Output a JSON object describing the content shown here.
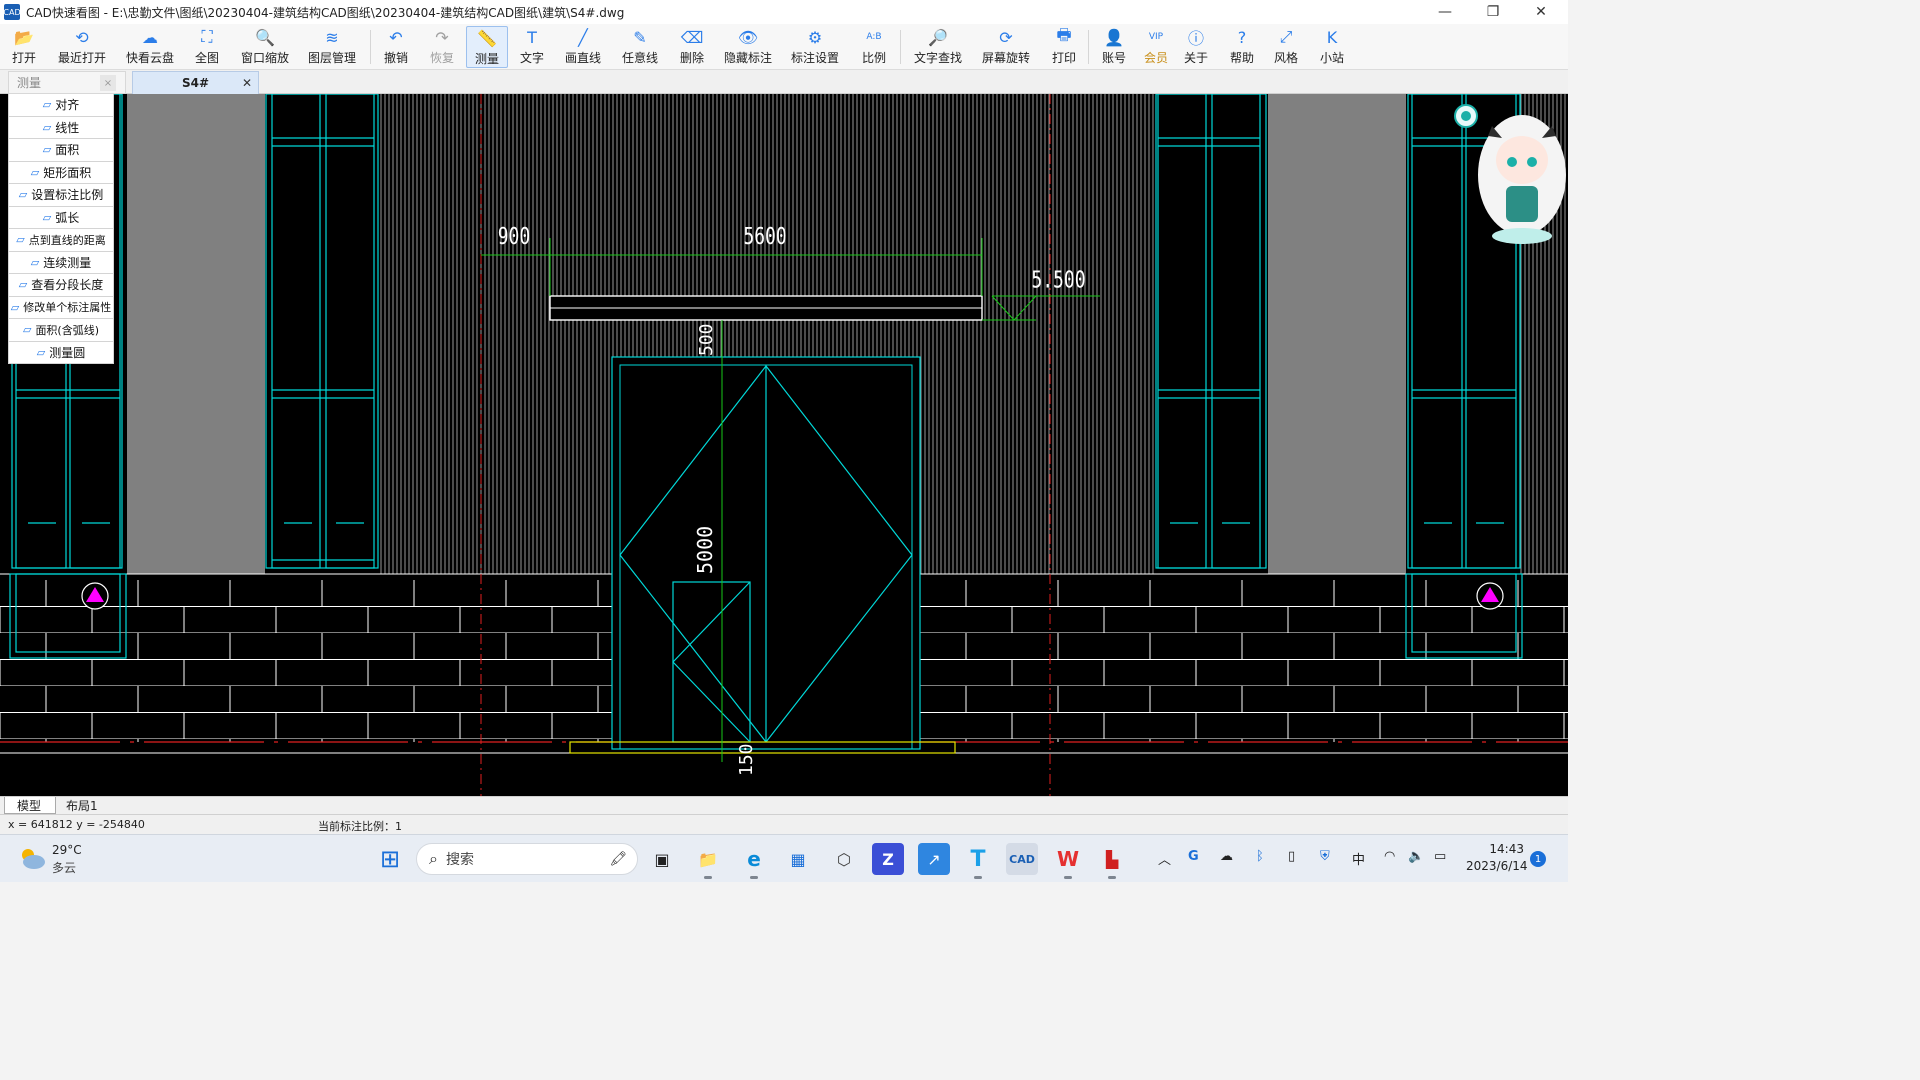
{
  "window": {
    "title": "CAD快速看图 - E:\\忠勤文件\\图纸\\20230404-建筑结构CAD图纸\\20230404-建筑结构CAD图纸\\建筑\\S4#.dwg",
    "app_icon_text": "CAD",
    "minimize": "—",
    "restore": "❐",
    "close": "✕"
  },
  "toolbar": {
    "items": [
      {
        "label": "打开",
        "icon": "folder-open-icon",
        "glyph": "📂"
      },
      {
        "label": "最近打开",
        "icon": "recent-icon",
        "glyph": "⟲"
      },
      {
        "label": "快看云盘",
        "icon": "cloud-icon",
        "glyph": "☁"
      },
      {
        "label": "全图",
        "icon": "fit-all-icon",
        "glyph": "⛶"
      },
      {
        "label": "窗口缩放",
        "icon": "zoom-window-icon",
        "glyph": "🔍"
      },
      {
        "label": "图层管理",
        "icon": "layers-icon",
        "glyph": "≋"
      },
      {
        "label": "撤销",
        "icon": "undo-icon",
        "glyph": "↶"
      },
      {
        "label": "恢复",
        "icon": "redo-icon",
        "glyph": "↷"
      },
      {
        "label": "测量",
        "icon": "measure-icon",
        "glyph": "📏"
      },
      {
        "label": "文字",
        "icon": "text-icon",
        "glyph": "T"
      },
      {
        "label": "画直线",
        "icon": "line-icon",
        "glyph": "╱"
      },
      {
        "label": "任意线",
        "icon": "pen-icon",
        "glyph": "✎"
      },
      {
        "label": "删除",
        "icon": "eraser-icon",
        "glyph": "⌫"
      },
      {
        "label": "隐藏标注",
        "icon": "eye-hide-icon",
        "glyph": "👁"
      },
      {
        "label": "标注设置",
        "icon": "dim-settings-icon",
        "glyph": "⚙"
      },
      {
        "label": "比例",
        "icon": "scale-icon",
        "glyph": "A:B"
      },
      {
        "label": "文字查找",
        "icon": "text-search-icon",
        "glyph": "🔎"
      },
      {
        "label": "屏幕旋转",
        "icon": "rotate-icon",
        "glyph": "⟳"
      },
      {
        "label": "打印",
        "icon": "printer-icon",
        "glyph": "🖶"
      },
      {
        "label": "账号",
        "icon": "user-icon",
        "glyph": "👤"
      },
      {
        "label": "会员",
        "icon": "vip-icon",
        "glyph": "VIP"
      },
      {
        "label": "关于",
        "icon": "info-icon",
        "glyph": "ⓘ"
      },
      {
        "label": "帮助",
        "icon": "help-icon",
        "glyph": "?"
      },
      {
        "label": "风格",
        "icon": "style-icon",
        "glyph": "⤢"
      },
      {
        "label": "小站",
        "icon": "station-icon",
        "glyph": "K"
      }
    ]
  },
  "tabs": {
    "panel_title": "测量",
    "doc_tab": "S4#",
    "close_glyph": "✕"
  },
  "measure_menu": [
    {
      "label": "对齐",
      "icon": "align-measure-icon"
    },
    {
      "label": "线性",
      "icon": "linear-measure-icon"
    },
    {
      "label": "面积",
      "icon": "area-icon"
    },
    {
      "label": "矩形面积",
      "icon": "rect-area-icon"
    },
    {
      "label": "设置标注比例",
      "icon": "dim-scale-icon"
    },
    {
      "label": "弧长",
      "icon": "arc-length-icon"
    },
    {
      "label": "点到直线的距离",
      "icon": "point-line-distance-icon"
    },
    {
      "label": "连续测量",
      "icon": "continuous-measure-icon"
    },
    {
      "label": "查看分段长度",
      "icon": "segment-length-icon"
    },
    {
      "label": "修改单个标注属性",
      "icon": "edit-dim-icon"
    },
    {
      "label": "面积(含弧线)",
      "icon": "arc-area-icon"
    },
    {
      "label": "测量圆",
      "icon": "measure-circle-icon"
    }
  ],
  "drawing": {
    "dims": {
      "d900": "900",
      "d5600": "5600",
      "elev": "5.500",
      "d500": "500",
      "d5000": "5000",
      "d150": "150"
    },
    "colors": {
      "background": "#000000",
      "cyan": "#00d8d8",
      "white": "#ffffff",
      "green": "#18c818",
      "red": "#e02020",
      "yellow": "#e6e600",
      "magenta": "#ff00ff",
      "gray": "#7f7f7f"
    }
  },
  "layout_tabs": [
    "模型",
    "布局1"
  ],
  "status": {
    "coords": "x = 641812 y = -254840",
    "scale": "当前标注比例：1"
  },
  "taskbar": {
    "weather_temp": "29°C",
    "weather_desc": "多云",
    "search_placeholder": "搜索",
    "ime": "中",
    "time": "14:43",
    "date": "2023/6/14",
    "notification_count": "1",
    "apps": [
      {
        "name": "start-button",
        "glyph": "⊞"
      },
      {
        "name": "task-view-icon",
        "glyph": "▣"
      },
      {
        "name": "file-explorer-icon",
        "glyph": "📁"
      },
      {
        "name": "edge-icon",
        "glyph": "e"
      },
      {
        "name": "store-icon",
        "glyph": "▦"
      },
      {
        "name": "app-cube-icon",
        "glyph": "⬡"
      },
      {
        "name": "app-z-icon",
        "glyph": "Z"
      },
      {
        "name": "app-arrow-icon",
        "glyph": "↗"
      },
      {
        "name": "app-t-icon",
        "glyph": "T"
      },
      {
        "name": "cad-app-icon",
        "glyph": "CAD"
      },
      {
        "name": "wps-icon",
        "glyph": "W"
      },
      {
        "name": "app-red-icon",
        "glyph": "▙"
      }
    ]
  }
}
